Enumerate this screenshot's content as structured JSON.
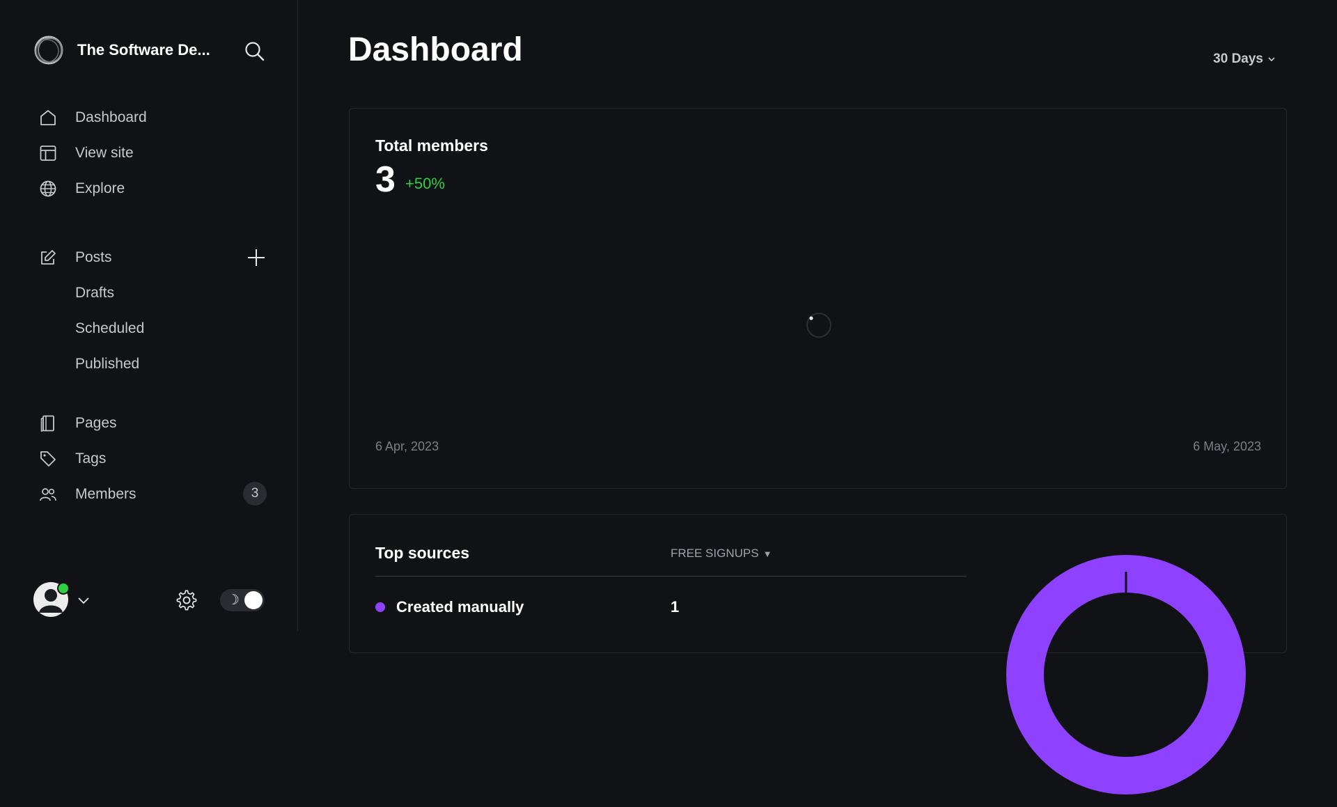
{
  "site": {
    "name": "The Software De..."
  },
  "nav": {
    "primary": [
      {
        "label": "Dashboard",
        "icon": "home-icon"
      },
      {
        "label": "View site",
        "icon": "layout-icon"
      },
      {
        "label": "Explore",
        "icon": "globe-icon"
      }
    ],
    "posts": {
      "label": "Posts",
      "icon": "pencil-icon",
      "sub": [
        {
          "label": "Drafts"
        },
        {
          "label": "Scheduled"
        },
        {
          "label": "Published"
        }
      ]
    },
    "secondary": [
      {
        "label": "Pages",
        "icon": "page-icon"
      },
      {
        "label": "Tags",
        "icon": "tag-icon"
      },
      {
        "label": "Members",
        "icon": "members-icon",
        "badge": "3"
      }
    ]
  },
  "footer": {
    "theme_symbol": "☽",
    "status_color": "#30cf43"
  },
  "header": {
    "title": "Dashboard",
    "period": "30 Days"
  },
  "members_card": {
    "label": "Total members",
    "value": "3",
    "delta": "+50%",
    "date_start": "6 Apr, 2023",
    "date_end": "6 May, 2023"
  },
  "sources_card": {
    "title": "Top sources",
    "column": "FREE SIGNUPS",
    "caret": "▼",
    "rows": [
      {
        "name": "Created manually",
        "count": "1",
        "color": "#8e42ff"
      }
    ]
  },
  "colors": {
    "background": "#111216",
    "accent_purple": "#8e42ff",
    "positive_green": "#30cf43"
  }
}
